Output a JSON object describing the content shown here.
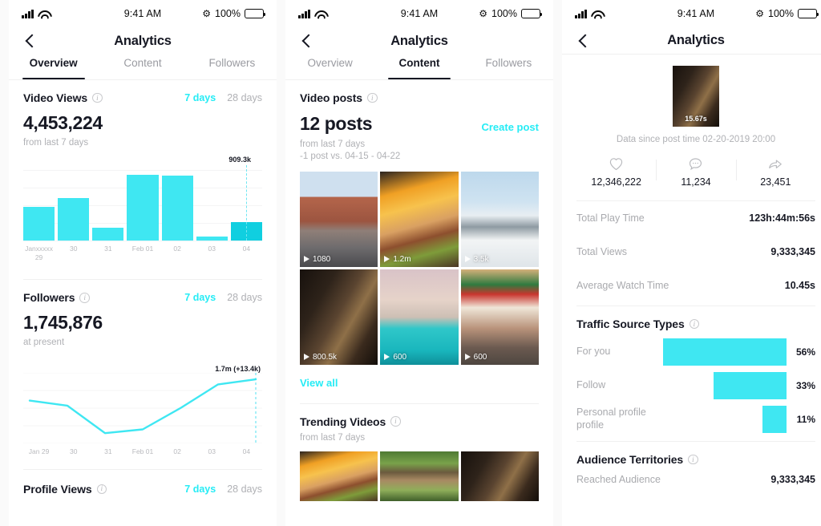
{
  "status_bar": {
    "time": "9:41 AM",
    "battery_pct": "100%",
    "bluetooth_icon": "bluetooth-icon",
    "signal_icon": "cellular-signal-icon",
    "wifi_icon": "wifi-icon",
    "battery_icon": "battery-icon"
  },
  "nav": {
    "title": "Analytics",
    "back_icon": "chevron-left-icon"
  },
  "panel1": {
    "tabs": [
      {
        "label": "Overview",
        "active": true
      },
      {
        "label": "Content",
        "active": false
      },
      {
        "label": "Followers",
        "active": false
      }
    ],
    "video_views": {
      "title": "Video Views",
      "info_icon": "info-icon",
      "range_7": "7 days",
      "range_28": "28 days",
      "value": "4,453,224",
      "subtitle": "from last 7 days",
      "marker_label": "909.3k"
    },
    "followers": {
      "title": "Followers",
      "info_icon": "info-icon",
      "range_7": "7 days",
      "range_28": "28 days",
      "value": "1,745,876",
      "subtitle": "at present",
      "marker_label": "1.7m (+13.4k)"
    },
    "profile_views": {
      "title": "Profile Views",
      "info_icon": "info-icon",
      "range_7": "7 days",
      "range_28": "28 days"
    }
  },
  "panel2": {
    "tabs": [
      {
        "label": "Overview",
        "active": false
      },
      {
        "label": "Content",
        "active": true
      },
      {
        "label": "Followers",
        "active": false
      }
    ],
    "video_posts": {
      "title": "Video posts",
      "info_icon": "info-icon",
      "count": "12 posts",
      "subtitle_1": "from last 7 days",
      "subtitle_2": "-1 post vs. 04-15 - 04-22",
      "create_post": "Create post",
      "view_all": "View all",
      "videos": [
        {
          "views": "1080",
          "alt": "city-street-buildings"
        },
        {
          "views": "1.2m",
          "alt": "burger-and-fries"
        },
        {
          "views": "3.5k",
          "alt": "snow-mountain-people"
        },
        {
          "views": "800.5k",
          "alt": "dark-colonnade-hallway"
        },
        {
          "views": "600",
          "alt": "venice-gondola-canal"
        },
        {
          "views": "600",
          "alt": "outdoor-cafe-terrace"
        }
      ]
    },
    "trending": {
      "title": "Trending Videos",
      "info_icon": "info-icon",
      "subtitle": "from last 7 days",
      "videos": [
        {
          "alt": "burger-and-fries"
        },
        {
          "alt": "deer-in-park"
        },
        {
          "alt": "dark-colonnade-hallway"
        }
      ]
    }
  },
  "panel3": {
    "video": {
      "duration": "15.67s",
      "alt": "dark-colonnade-hallway",
      "since": "Data since post time 02-20-2019 20:00"
    },
    "engagement": [
      {
        "icon": "heart-icon",
        "value": "12,346,222"
      },
      {
        "icon": "comment-icon",
        "value": "11,234"
      },
      {
        "icon": "share-icon",
        "value": "23,451"
      }
    ],
    "metrics": [
      {
        "key": "Total Play Time",
        "value": "123h:44m:56s"
      },
      {
        "key": "Total Views",
        "value": "9,333,345"
      },
      {
        "key": "Average Watch Time",
        "value": "10.45s"
      }
    ],
    "traffic": {
      "title": "Traffic Source Types",
      "info_icon": "info-icon",
      "rows": [
        {
          "label": "For you",
          "pct": "56%"
        },
        {
          "label": "Follow",
          "pct": "33%"
        },
        {
          "label": "Personal profile profile",
          "pct": "11%"
        }
      ]
    },
    "territories": {
      "title": "Audience Territories",
      "info_icon": "info-icon",
      "row": {
        "key": "Reached Audience",
        "value": "9,333,345"
      }
    }
  },
  "chart_data": [
    {
      "type": "bar",
      "title": "Video Views",
      "categories": [
        "Janxxxxx\n29",
        "30",
        "31",
        "Feb 01",
        "02",
        "03",
        "04"
      ],
      "values": [
        480,
        600,
        180,
        930,
        915,
        55,
        260
      ],
      "ylim": [
        0,
        1000
      ],
      "annotation": "909.3k",
      "annotation_index": 6,
      "grid": true,
      "xlabel": "",
      "ylabel": ""
    },
    {
      "type": "line",
      "title": "Followers",
      "x": [
        "Jan 29",
        "30",
        "31",
        "Feb 01",
        "02",
        "03",
        "04"
      ],
      "values": [
        1712,
        1704,
        1660,
        1666,
        1700,
        1738,
        1746
      ],
      "ylim": [
        1650,
        1750
      ],
      "annotation": "1.7m (+13.4k)",
      "annotation_index": 6,
      "grid": true,
      "xlabel": "",
      "ylabel": ""
    },
    {
      "type": "bar",
      "title": "Traffic Source Types",
      "orientation": "horizontal",
      "categories": [
        "For you",
        "Follow",
        "Personal profile profile"
      ],
      "values": [
        56,
        33,
        11
      ],
      "value_labels": [
        "56%",
        "33%",
        "11%"
      ],
      "ylim": [
        0,
        100
      ],
      "grid": false
    }
  ]
}
